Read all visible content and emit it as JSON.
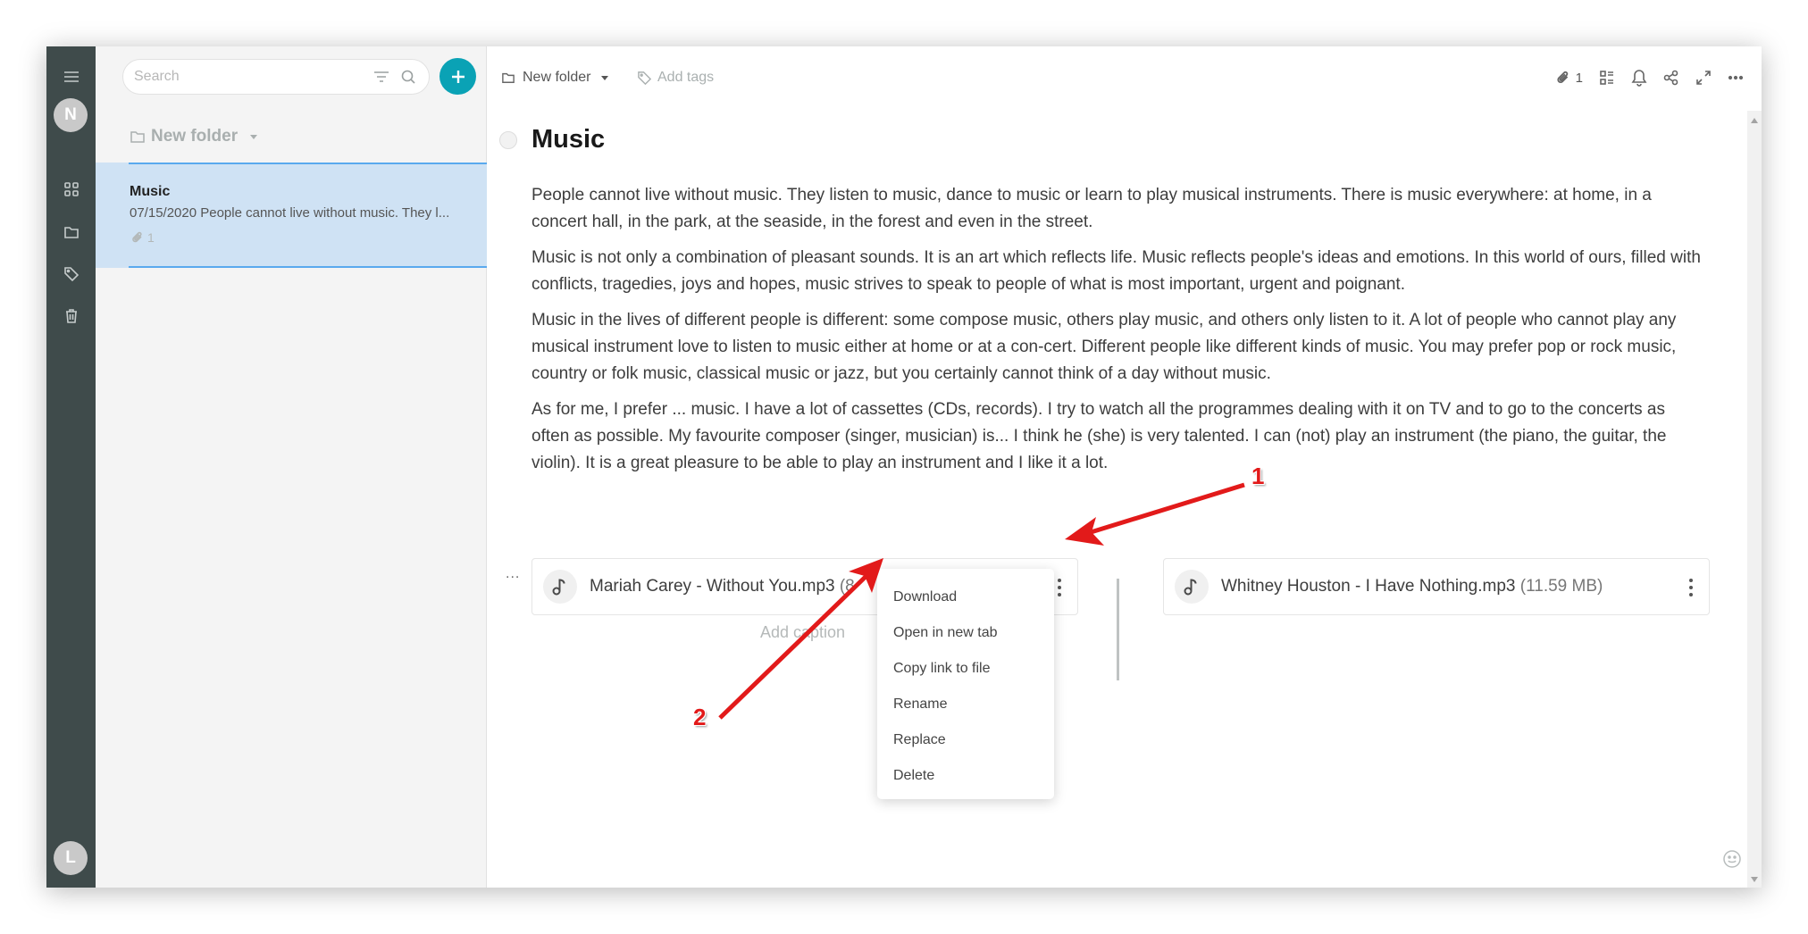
{
  "rail": {
    "user_initial": "N",
    "bottom_initial": "L",
    "items": [
      {
        "name": "menu",
        "icon": "hamburger-icon"
      },
      {
        "name": "dashboard",
        "icon": "grid-icon"
      },
      {
        "name": "folders",
        "icon": "folder-icon"
      },
      {
        "name": "tags",
        "icon": "tag-icon"
      },
      {
        "name": "trash",
        "icon": "trash-icon"
      }
    ]
  },
  "list": {
    "search_placeholder": "Search",
    "folder_name": "New folder",
    "notes": [
      {
        "title": "Music",
        "snippet": "07/15/2020 People cannot live without music. They l...",
        "attachments": "1",
        "selected": true
      }
    ]
  },
  "editor": {
    "breadcrumb_folder": "New folder",
    "add_tags_label": "Add tags",
    "attachment_count": "1",
    "title": "Music",
    "paragraphs": [
      "People cannot live without music. They listen to music, dance to music or learn to play musical instruments. There is music everywhere: at home, in a concert hall, in the park, at the seaside, in the forest and even in the street.",
      "Music is not only a combination of pleasant sounds. It is an art which reflects life. Music reflects people's ideas and emotions. In this world of ours, filled with conflicts, tragedies, joys and hopes, music strives to speak to people of what is most important, urgent and poignant.",
      "Music in the lives of different people is different: some compose music, others play music, and others only listen to it. A lot of people who cannot play any musical instrument love to listen to music either at home or at a con-cert. Different people like different kinds of music. You may prefer pop or rock music, country or folk music, classical music or jazz, but you certainly cannot think of a day without music.",
      "As for me, I prefer ... music. I have a lot of cassettes (CDs, records). I try to watch all the programmes dealing with it on TV and to go to the concerts as often as possible. My favourite composer (singer, musician) is... I think he (she) is very talented. I can (not) play an instrument (the piano, the guitar, the violin). It is a great pleasure to be able to play an instrument and I like it a lot."
    ],
    "block_handle": "...",
    "files": [
      {
        "name": "Mariah Carey - Without You.mp3",
        "size": "(8"
      },
      {
        "name": "Whitney Houston - I Have Nothing.mp3",
        "size": "(11.59 MB)"
      }
    ],
    "caption_placeholder": "Add caption",
    "context_menu": [
      "Download",
      "Open in new tab",
      "Copy link to file",
      "Rename",
      "Replace",
      "Delete"
    ]
  },
  "annotations": {
    "label_1": "1",
    "label_2": "2",
    "color": "#e21a1a"
  },
  "colors": {
    "rail_bg": "#3f4b4b",
    "accent": "#0aa2b5",
    "selected_note_bg": "#cfe2f4",
    "selected_note_border": "#5aa9ee"
  }
}
